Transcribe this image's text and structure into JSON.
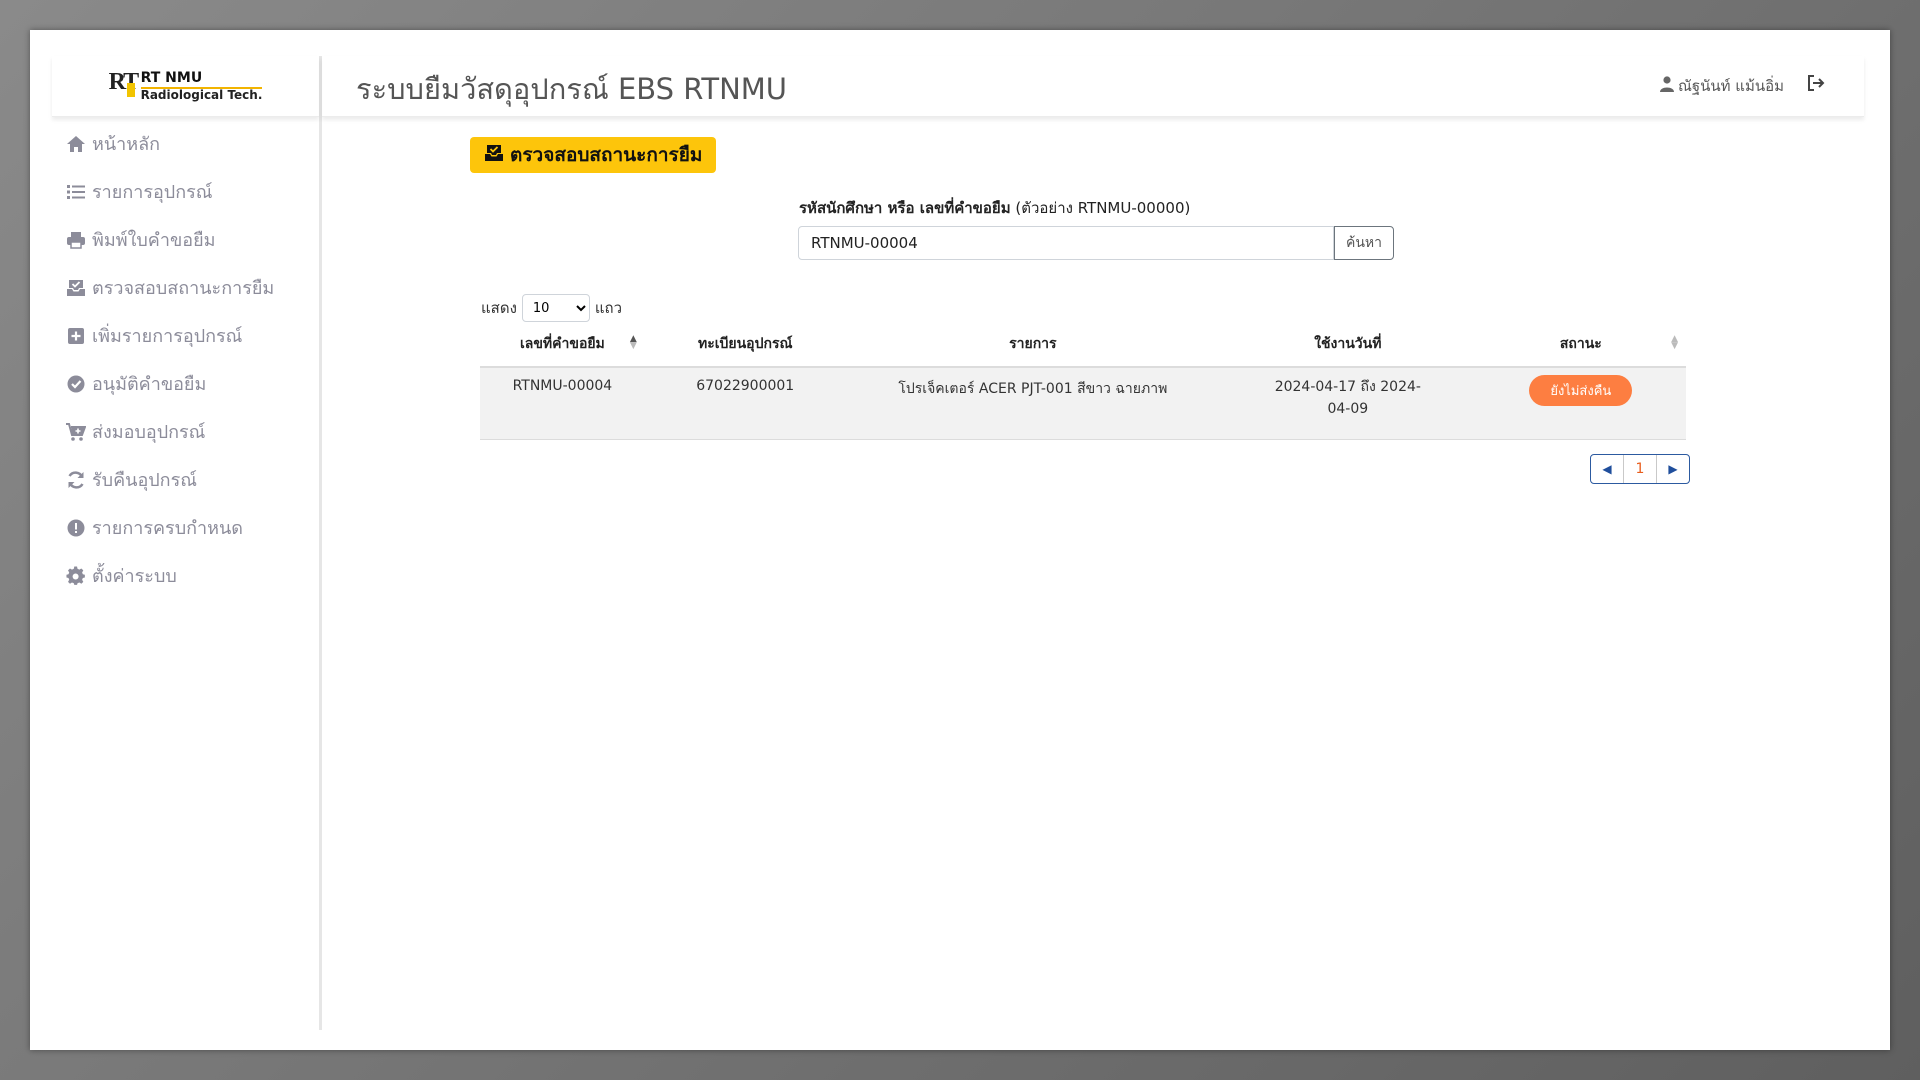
{
  "brand": {
    "line1": "RT NMU",
    "line2": "Radiological Tech.",
    "mark": "RT"
  },
  "header": {
    "title": "ระบบยืมวัสดุอุปกรณ์ EBS RTNMU",
    "user_name": "ณัฐนันท์ แม้นอิ่ม",
    "user_icon": "user-icon",
    "logout_icon": "logout-icon"
  },
  "sidebar": {
    "items": [
      {
        "label": "หน้าหลัก",
        "icon": "home-icon"
      },
      {
        "label": "รายการอุปกรณ์",
        "icon": "list-icon"
      },
      {
        "label": "พิมพ์ใบคำขอยืม",
        "icon": "printer-icon"
      },
      {
        "label": "ตรวจสอบสถานะการยืม",
        "icon": "inbox-check-icon"
      },
      {
        "label": "เพิ่มรายการอุปกรณ์",
        "icon": "plus-square-icon"
      },
      {
        "label": "อนุมัติคำขอยืม",
        "icon": "check-circle-icon"
      },
      {
        "label": "ส่งมอบอุปกรณ์",
        "icon": "cart-plus-icon"
      },
      {
        "label": "รับคืนอุปกรณ์",
        "icon": "sync-icon"
      },
      {
        "label": "รายการครบกำหนด",
        "icon": "exclamation-circle-icon"
      },
      {
        "label": "ตั้งค่าระบบ",
        "icon": "gear-icon"
      }
    ]
  },
  "main": {
    "section_button": "ตรวจสอบสถานะการยืม",
    "search": {
      "label_bold": "รหัสนักศึกษา หรือ เลขที่คำขอยืม",
      "label_hint": "(ตัวอย่าง RTNMU-00000)",
      "value": "RTNMU-00004",
      "button": "ค้นหา"
    },
    "length": {
      "prefix": "แสดง",
      "value": "10",
      "suffix": "แถว"
    },
    "table": {
      "columns": [
        "เลขที่คำขอยืม",
        "ทะเบียนอุปกรณ์",
        "รายการ",
        "ใช้งานวันที่",
        "สถานะ"
      ],
      "rows": [
        {
          "request_no": "RTNMU-00004",
          "asset_no": "67022900001",
          "item": "โปรเจ็คเตอร์ ACER PJT-001 สีขาว ฉายภาพ",
          "date_line1": "2024-04-17 ถึง 2024-",
          "date_line2": "04-09",
          "status": "ยังไม่ส่งคืน"
        }
      ]
    },
    "pager": {
      "current": "1"
    },
    "colors": {
      "accent": "#fdc50b",
      "status": "#fd7e41",
      "pager": "#1f4e9c"
    }
  }
}
